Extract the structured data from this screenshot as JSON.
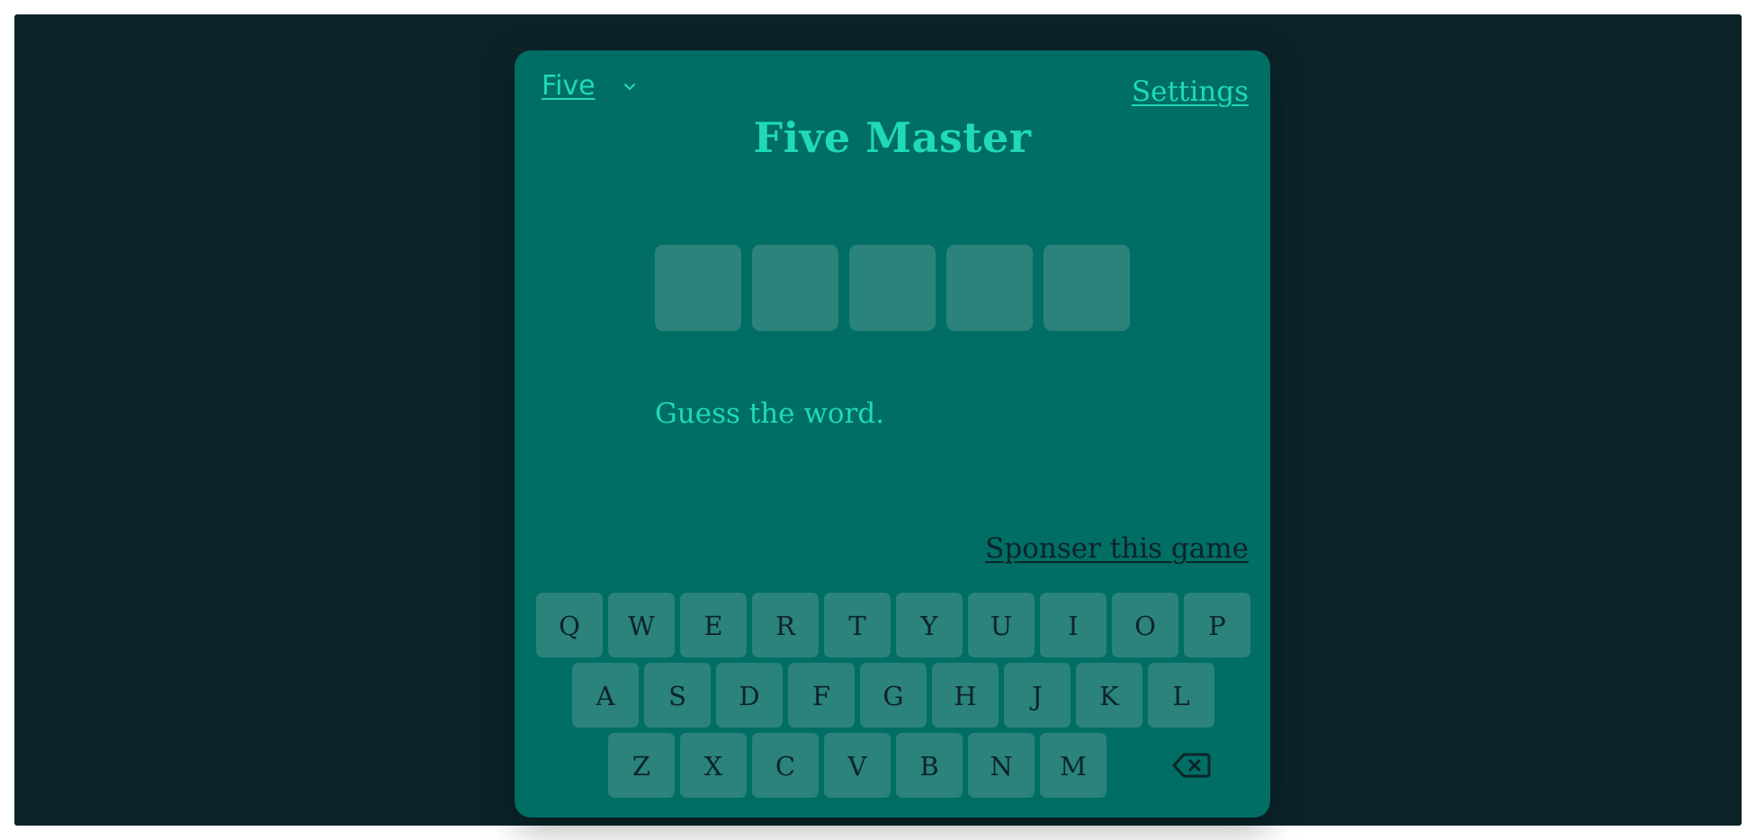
{
  "colors": {
    "page_background": "#0c2429",
    "card_background": "#006e64",
    "accent": "#1fd9b8",
    "tile": "#2b837b",
    "key_text": "#0c2429"
  },
  "header": {
    "mode_label": "Five",
    "mode_chevron_icon": "chevron-down-icon",
    "settings_label": "Settings"
  },
  "game": {
    "title": "Five Master",
    "tile_count": 5,
    "message": "Guess the word.",
    "sponsor_label": "Sponser this game"
  },
  "keyboard": {
    "rows": [
      [
        "Q",
        "W",
        "E",
        "R",
        "T",
        "Y",
        "U",
        "I",
        "O",
        "P"
      ],
      [
        "A",
        "S",
        "D",
        "F",
        "G",
        "H",
        "J",
        "K",
        "L"
      ],
      [
        "Z",
        "X",
        "C",
        "V",
        "B",
        "N",
        "M"
      ]
    ],
    "backspace_icon": "backspace-icon"
  }
}
